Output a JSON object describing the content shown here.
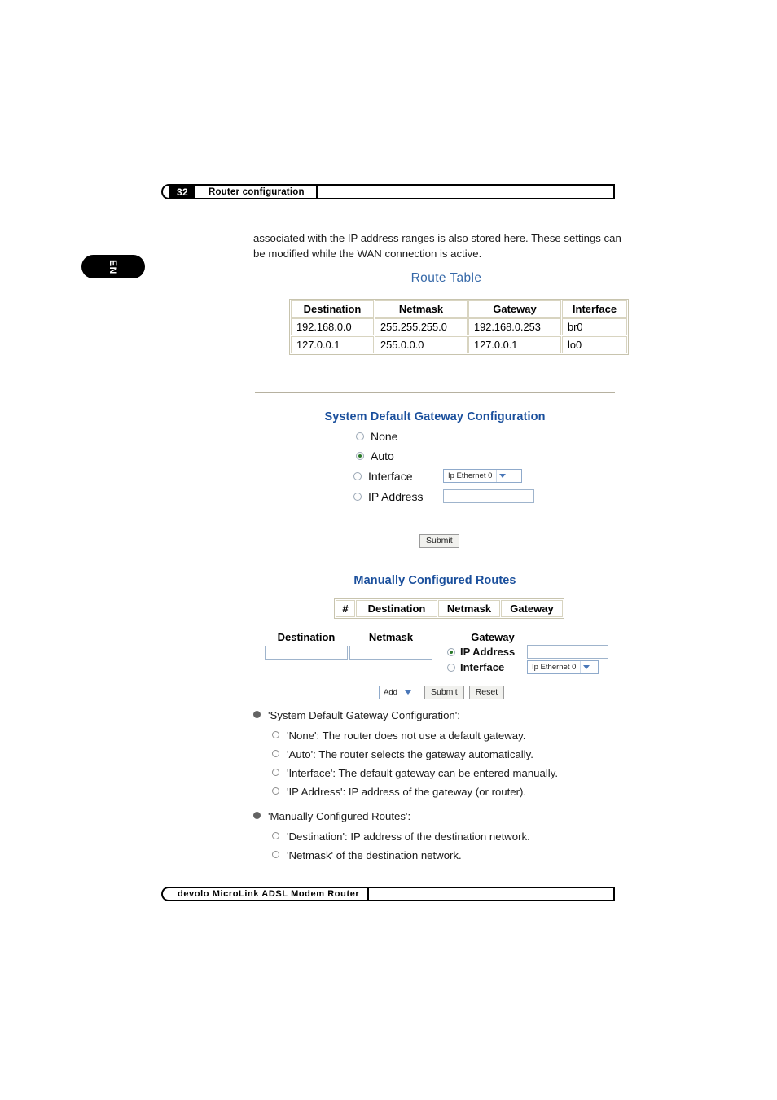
{
  "page_header": {
    "page_number": "32",
    "section_title": "Router configuration"
  },
  "language_tab": {
    "label": "EN"
  },
  "intro_paragraph": "associated with the IP address ranges is also stored here. These settings can be modified while the WAN connection is active.",
  "route_table": {
    "heading": "Route Table",
    "columns": [
      "Destination",
      "Netmask",
      "Gateway",
      "Interface"
    ],
    "rows": [
      [
        "192.168.0.0",
        "255.255.255.0",
        "192.168.0.253",
        "br0"
      ],
      [
        "127.0.0.1",
        "255.0.0.0",
        "127.0.0.1",
        "lo0"
      ]
    ]
  },
  "gateway_config": {
    "heading": "System Default Gateway Configuration",
    "options": [
      {
        "label": "None",
        "selected": false
      },
      {
        "label": "Auto",
        "selected": true
      },
      {
        "label": "Interface",
        "selected": false
      },
      {
        "label": "IP Address",
        "selected": false
      }
    ],
    "interface_select_value": "Ip Ethernet 0",
    "ip_address_value": "",
    "submit_label": "Submit"
  },
  "manual_routes": {
    "heading": "Manually Configured Routes",
    "columns": [
      "#",
      "Destination",
      "Netmask",
      "Gateway"
    ],
    "rows": [],
    "form": {
      "destination_label": "Destination",
      "destination_value": "",
      "netmask_label": "Netmask",
      "netmask_value": "",
      "gateway_label": "Gateway",
      "gateway_ip_label": "IP Address",
      "gateway_ip_selected": true,
      "gateway_ip_value": "",
      "gateway_interface_label": "Interface",
      "gateway_interface_selected": false,
      "gateway_interface_select_value": "Ip Ethernet 0",
      "action_select_value": "Add",
      "submit_label": "Submit",
      "reset_label": "Reset"
    }
  },
  "explanations": [
    {
      "title": "'System Default Gateway Configuration':",
      "items": [
        "'None': The router does not use a default gateway.",
        "'Auto': The router selects the gateway automatically.",
        "'Interface': The default gateway can be entered manually.",
        "'IP Address': IP address of the gateway (or router)."
      ]
    },
    {
      "title": "'Manually Configured Routes':",
      "items": [
        "'Destination': IP address of the destination network.",
        "'Netmask' of the destination network."
      ]
    }
  ],
  "page_footer": {
    "product": "devolo  MicroLink  ADSL  Modem  Router"
  },
  "colors": {
    "heading_light_blue": "#3568a8",
    "heading_dark_blue": "#1a4f9c",
    "radio_selected_green": "#2a7a2a",
    "select_border_blue": "#8faacb",
    "bullet_gray": "#636363"
  }
}
